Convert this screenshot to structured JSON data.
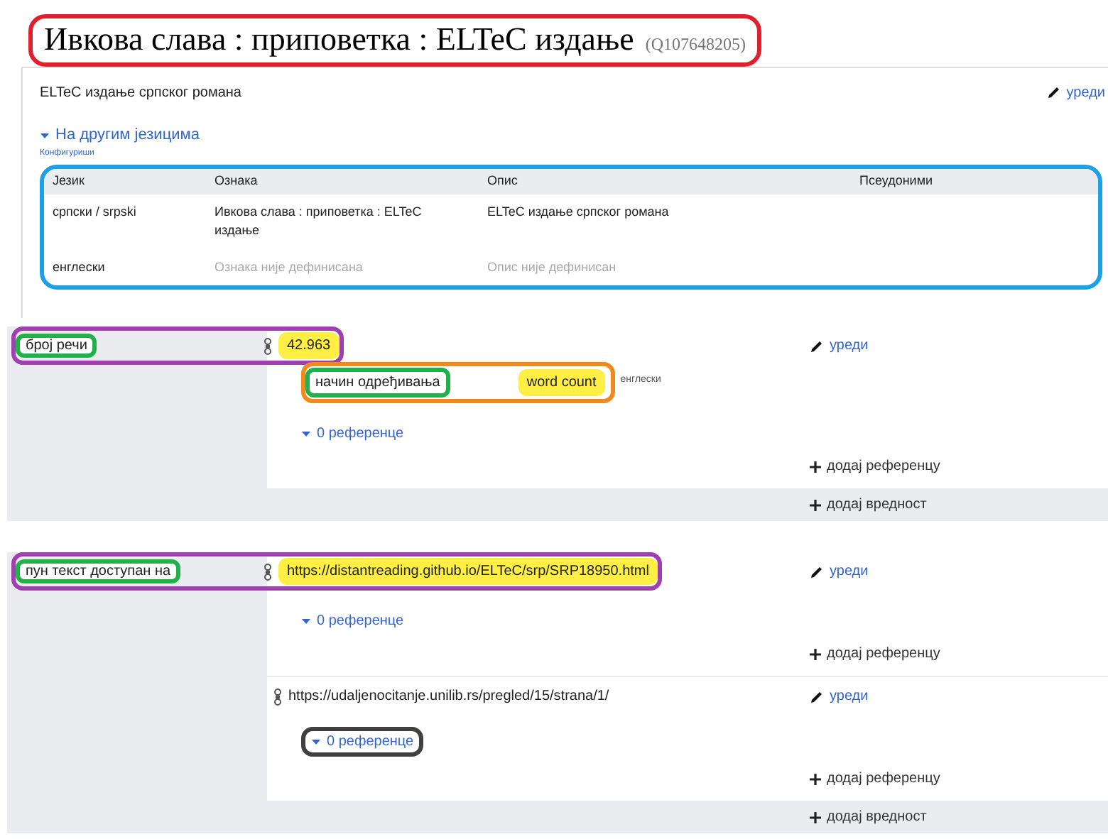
{
  "header": {
    "title": "Ивкова слава : приповетка : ELTeC издање",
    "id": "(Q107648205)",
    "outline": {
      "color": "#e0202e"
    }
  },
  "description": {
    "text": "ELTeC издање српског романа",
    "edit": "уреди"
  },
  "other_languages": {
    "toggle": "На другим језицима",
    "expanded": true,
    "configure": "Конфигуриши"
  },
  "languages_table": {
    "outline": {
      "color": "#1ea0e6"
    },
    "columns": [
      "Језик",
      "Ознака",
      "Опис",
      "Псеудоними"
    ],
    "rows": [
      [
        {
          "text": "српски / srpski",
          "muted": false
        },
        {
          "text": "Ивкова слава : приповетка : ELTeC издање",
          "muted": false
        },
        {
          "text": "ELTeC издање српског романа",
          "muted": false
        }
      ],
      [
        {
          "text": "енглески",
          "muted": false
        },
        {
          "text": "Ознака није дефинисана",
          "muted": true
        },
        {
          "text": "Опис није дефинисан",
          "muted": true
        }
      ]
    ]
  },
  "statements": [
    {
      "property": "број речи",
      "property_outline": {
        "color": "#22b04a"
      },
      "row_outline": {
        "color": "#a03fb0"
      },
      "add_value": "додај вредност",
      "values": [
        {
          "value": "42.963",
          "value_highlight": {
            "color": "#ffee44"
          },
          "edit": "уреди",
          "references": "0 референце",
          "add_reference": "додај референцу",
          "qualifiers": [
            {
              "property": "начин одређивања",
              "value": "word count",
              "note": "енглески",
              "outline": {
                "color": "#f08a1e"
              },
              "property_outline": {
                "color": "#22b04a"
              },
              "value_highlight": {
                "color": "#ffee44"
              }
            }
          ]
        }
      ]
    },
    {
      "property": "пун текст доступан на",
      "property_outline": {
        "color": "#22b04a"
      },
      "row_outline": {
        "color": "#a03fb0"
      },
      "add_value": "додај вредност",
      "values": [
        {
          "value": "https://distantreading.github.io/ELTeC/srp/SRP18950.html",
          "value_highlight": {
            "color": "#ffee44"
          },
          "edit": "уреди",
          "references": "0 референце",
          "add_reference": "додај референцу"
        },
        {
          "value": "https://udaljenocitanje.unilib.rs/pregled/15/strana/1/",
          "edit": "уреди",
          "references": "0 референце",
          "references_outline": {
            "color": "#404040"
          },
          "add_reference": "додај референцу"
        }
      ]
    }
  ]
}
